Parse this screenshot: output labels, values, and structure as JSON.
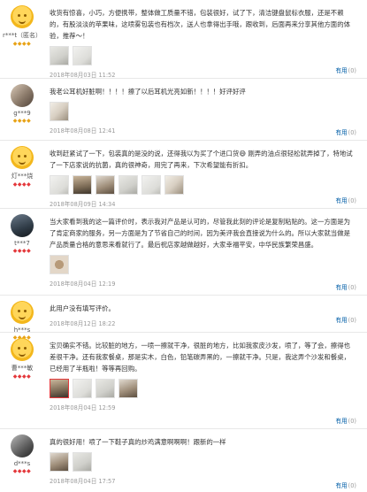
{
  "reviews": [
    {
      "username": "r***t（匿名）",
      "level": "◆◆◆◆",
      "level_color": "#e8a317",
      "text": "收货有惊喜，小巧，方便携带，整体做工质量不错，包装很好，试了下，清洁键盘鼠标衣服，还是不赖的，有股淡淡的苹果味，这喷雾包装也有档次，送人也拿得出手哦，跟收到，后面再来分享其他方面的体验，推荐～！",
      "pics": [
        "photo",
        "photo"
      ],
      "date": "2018年08月03日 11:52",
      "useful_label": "有用",
      "useful_count": "(0)"
    },
    {
      "username": "g***9",
      "level": "◆◆◆◆",
      "level_color": "#e8a317",
      "text": "我老公耳机好脏啊！！！！擦了以后耳机光亮如新！！！！好评好评",
      "pics": [
        "photo"
      ],
      "date": "2018年08月08日 12:41",
      "useful_label": "有用",
      "useful_count": "(0)"
    },
    {
      "username": "灯***烧",
      "level": "◆◆◆◆",
      "level_color": "#e4393c",
      "text": "收到赶紧试了一下，包装真的是没的说，还得我以为买了个进口货😅 刚弄的油点很轻松就弄掉了，特地试了一下店家说的抗菌，真的很神奇，用完了再来，下次希望能有折扣。",
      "pics": [
        "photo",
        "photo",
        "photo",
        "photo",
        "photo",
        "photo"
      ],
      "date": "2018年08月09日 14:34",
      "useful_label": "有用",
      "useful_count": "(0)"
    },
    {
      "username": "t***7",
      "level": "◆◆◆◆",
      "level_color": "#e4393c",
      "text": "当大家看到我的这一篇评价时，表示我对产品是认可的，尽管我此刻的评论是复制粘贴的。这一方面是为了肯定商家的服务，另一方面是为了节省自己的时间，因为美评我会直接说为什么的。所以大家就当做是产品质量合格的意思来看就行了。最后祝店家越做越好，大家幸福平安，中华民族繁荣昌盛。",
      "pics": [
        "photo"
      ],
      "date": "2018年08月04日 12:19",
      "useful_label": "有用",
      "useful_count": "(0)"
    },
    {
      "username": "h***s",
      "level": "◆◆◆◆",
      "level_color": "#e8a317",
      "text": "此用户没有填写评价。",
      "pics": [],
      "date": "2018年08月12日 18:22",
      "useful_label": "有用",
      "useful_count": "(0)"
    },
    {
      "username": "曹***敏",
      "level": "◆◆◆◆",
      "level_color": "#e4393c",
      "text": "宝贝确实不错。比较脏的地方，一喷一擦就干净，很脏的地方，比如我家皮沙发，喷了，等了会，擦得也差很干净。还有我家餐桌，那是实木，白色，铅笔碳弄黑的，一擦就干净。只是，我这弄个沙发和餐桌，已经用了半瓶啦！等等再回购。",
      "pics": [
        "photo",
        "photo",
        "photo",
        "photo"
      ],
      "date": "2018年08月04日 12:59",
      "useful_label": "有用",
      "useful_count": "(0)"
    },
    {
      "username": "d***s",
      "level": "◆◆◆◆",
      "level_color": "#e4393c",
      "text": "真的很好用！喷了一下鞋子真的炒鸡满意啊啊啊！跟新的一样",
      "pics": [
        "photo",
        "photo"
      ],
      "date": "2018年08月04日 17:57",
      "useful_label": "有用",
      "useful_count": "(0)"
    }
  ]
}
